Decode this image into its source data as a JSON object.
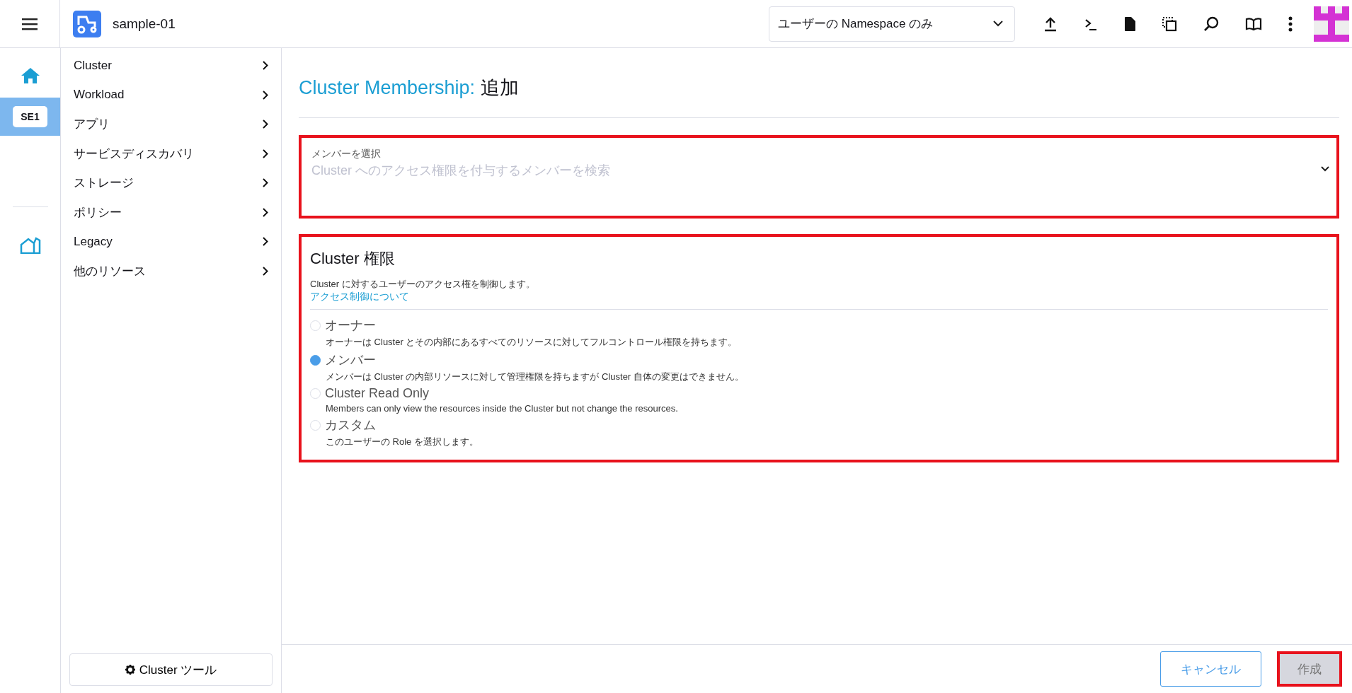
{
  "header": {
    "cluster_name": "sample-01",
    "namespace_filter": "ユーザーの Namespace のみ"
  },
  "rail": {
    "cluster_badge": "SE1",
    "selected": true
  },
  "nav": {
    "items": [
      {
        "label": "Cluster"
      },
      {
        "label": "Workload"
      },
      {
        "label": "アプリ"
      },
      {
        "label": "サービスディスカバリ"
      },
      {
        "label": "ストレージ"
      },
      {
        "label": "ポリシー"
      },
      {
        "label": "Legacy"
      },
      {
        "label": "他のリソース"
      }
    ],
    "tools_button": "Cluster ツール"
  },
  "page": {
    "title_prefix": "Cluster Membership:",
    "title_action": "追加"
  },
  "member_select": {
    "label": "メンバーを選択",
    "placeholder": "Cluster へのアクセス権限を付与するメンバーを検索",
    "highlighted": true
  },
  "permissions": {
    "title": "Cluster 権限",
    "description": "Cluster に対するユーザーのアクセス権を制御します。",
    "link": "アクセス制御について",
    "highlighted": true,
    "options": [
      {
        "label": "オーナー",
        "description": "オーナーは Cluster とその内部にあるすべてのリソースに対してフルコントロール権限を持ちます。",
        "selected": false
      },
      {
        "label": "メンバー",
        "description": "メンバーは Cluster の内部リソースに対して管理権限を持ちますが Cluster 自体の変更はできません。",
        "selected": true
      },
      {
        "label": "Cluster Read Only",
        "description": "Members can only view the resources inside the Cluster but not change the resources.",
        "selected": false
      },
      {
        "label": "カスタム",
        "description": "このユーザーの Role を選択します。",
        "selected": false
      }
    ]
  },
  "footer": {
    "cancel_button": "キャンセル",
    "create_button": {
      "label": "作成",
      "highlighted": true
    }
  }
}
